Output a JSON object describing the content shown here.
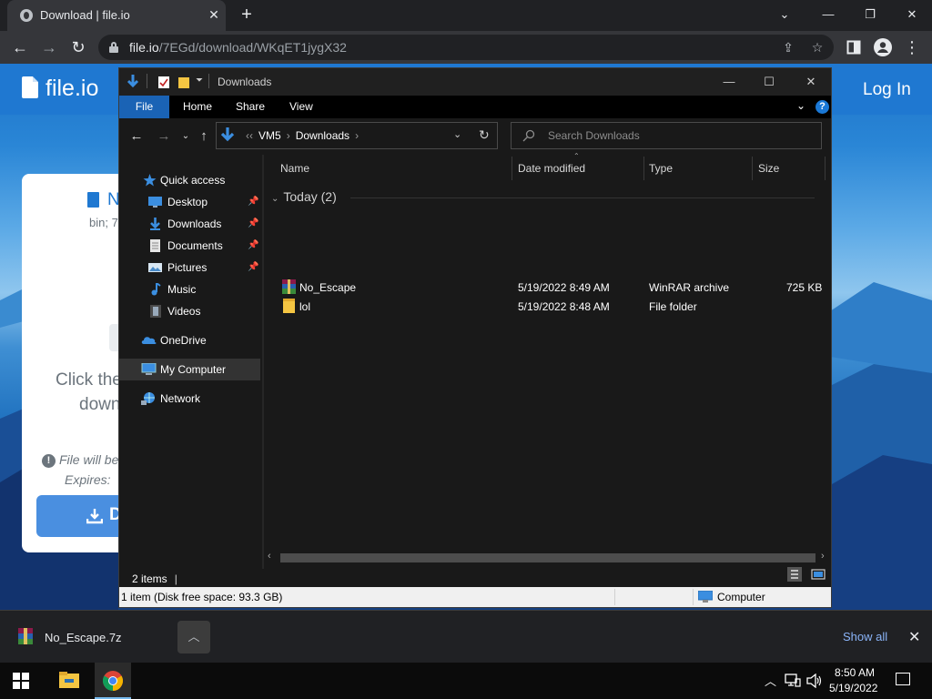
{
  "browser": {
    "tab_title": "Download | file.io",
    "url_host": "file.io",
    "url_path": "/7EGd/download/WKqET1jygX32"
  },
  "page": {
    "logo": "file.io",
    "login": "Log In",
    "card_file_name": "N",
    "card_meta": "bin; 7",
    "card_text_line1": "Click the",
    "card_text_line2": "down",
    "card_note_line1": "File will be",
    "card_note_line2": "Expires:",
    "download_button_label": "D"
  },
  "explorer": {
    "title": "Downloads",
    "ribbon_tabs": [
      "File",
      "Home",
      "Share",
      "View"
    ],
    "help": "?",
    "breadcrumb": [
      "VM5",
      "Downloads"
    ],
    "search_placeholder": "Search Downloads",
    "nav": [
      {
        "label": "Quick access",
        "icon": "star-icon"
      },
      {
        "label": "Desktop",
        "icon": "desktop-icon",
        "pinned": true
      },
      {
        "label": "Downloads",
        "icon": "download-folder-icon",
        "pinned": true
      },
      {
        "label": "Documents",
        "icon": "documents-icon",
        "pinned": true
      },
      {
        "label": "Pictures",
        "icon": "pictures-icon",
        "pinned": true
      },
      {
        "label": "Music",
        "icon": "music-icon"
      },
      {
        "label": "Videos",
        "icon": "videos-icon"
      },
      {
        "label": "OneDrive",
        "icon": "onedrive-icon"
      },
      {
        "label": "My Computer",
        "icon": "computer-icon",
        "selected": true
      },
      {
        "label": "Network",
        "icon": "network-icon"
      }
    ],
    "columns": [
      "Name",
      "Date modified",
      "Type",
      "Size"
    ],
    "group_label": "Today (2)",
    "files": [
      {
        "name": "No_Escape",
        "date": "5/19/2022 8:49 AM",
        "type": "WinRAR archive",
        "size": "725 KB",
        "icon": "winrar-archive-icon"
      },
      {
        "name": "lol",
        "date": "5/19/2022 8:48 AM",
        "type": "File folder",
        "size": "",
        "icon": "folder-icon"
      }
    ],
    "status_items": "2 items",
    "status_selection": "1 item (Disk free space: 93.3 GB)",
    "status_location": "Computer"
  },
  "download_bar": {
    "file_name": "No_Escape.7z",
    "show_all": "Show all"
  },
  "taskbar": {
    "time": "8:50 AM",
    "date": "5/19/2022"
  },
  "colors": {
    "chrome_bg": "#202124",
    "explorer_bg": "#191919",
    "accent": "#1a63b5",
    "fileio_blue": "#1f78d1"
  }
}
